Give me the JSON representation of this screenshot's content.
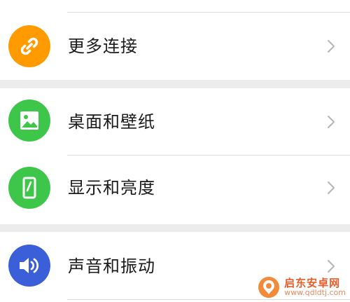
{
  "colors": {
    "more_connections_icon_bg": "#ff9b00",
    "wallpaper_icon_bg": "#3ec64a",
    "display_icon_bg": "#3ec64a",
    "sound_icon_bg": "#3a5fd9",
    "chevron": "#b5b5b5",
    "page_background": "#ececec"
  },
  "settings": {
    "items": [
      {
        "label": "更多连接",
        "icon": "link-icon"
      },
      {
        "label": "桌面和壁纸",
        "icon": "image-icon"
      },
      {
        "label": "显示和亮度",
        "icon": "phone-brightness-icon"
      },
      {
        "label": "声音和振动",
        "icon": "speaker-icon"
      }
    ]
  },
  "watermark": {
    "title": "启东安卓网",
    "url": "www.qdldtj.com"
  }
}
